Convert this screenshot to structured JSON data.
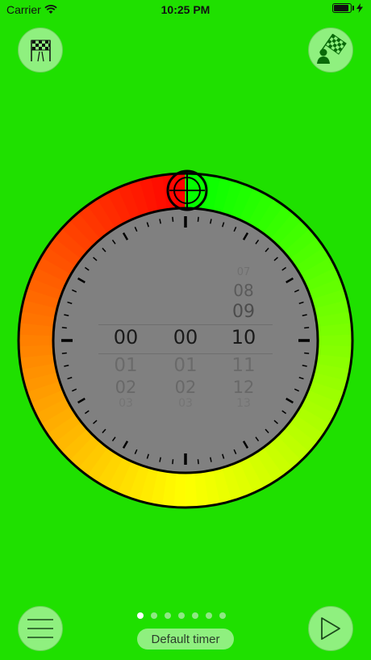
{
  "status_bar": {
    "carrier": "Carrier",
    "time": "10:25 PM"
  },
  "buttons": {
    "start_icon": "checkered-flag-road-icon",
    "finish_icon": "player-checkered-flag-icon",
    "menu_icon": "hamburger-menu-icon",
    "play_icon": "play-icon"
  },
  "dial": {
    "crosshair_icon": "crosshair-icon",
    "ring_colors": {
      "start": "#ff0000",
      "mid": "#ffff00",
      "end": "#00ff00"
    },
    "face_color": "#808080"
  },
  "picker": {
    "hours": {
      "above": [],
      "selected": "00",
      "below": [
        "01",
        "02",
        "03"
      ]
    },
    "minutes": {
      "above": [],
      "selected": "00",
      "below": [
        "01",
        "02",
        "03"
      ]
    },
    "seconds": {
      "above": [
        "07",
        "08",
        "09"
      ],
      "selected": "10",
      "below": [
        "11",
        "12",
        "13"
      ]
    }
  },
  "pager": {
    "count": 7,
    "active_index": 0
  },
  "profile_label": "Default timer"
}
